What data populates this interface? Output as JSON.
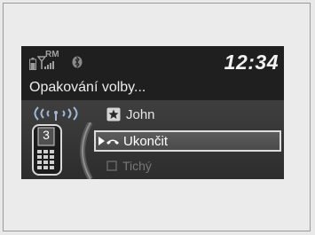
{
  "status": {
    "time": "12:34",
    "signal_label": "RM",
    "icons": [
      "battery-icon",
      "signal-strength-icon",
      "bluetooth-icon"
    ]
  },
  "screen": {
    "title": "Opakování volby..."
  },
  "side": {
    "dial_number": "3",
    "icons": [
      "wireless-signal-icon",
      "phone-keypad-icon"
    ]
  },
  "list": {
    "items": [
      {
        "label": "John",
        "icon": "star-icon",
        "selected": false
      },
      {
        "label": "Ukončit",
        "icon": "hang-up-icon",
        "selected": true
      },
      {
        "label": "Tichý",
        "icon": "mute-icon",
        "selected": false
      }
    ]
  },
  "colors": {
    "screen_bg": "#1f1f1f",
    "band_bg": "#3a3a3a",
    "text": "#ececec",
    "disabled_text": "#777777",
    "highlight_border": "#dcdcdc"
  }
}
